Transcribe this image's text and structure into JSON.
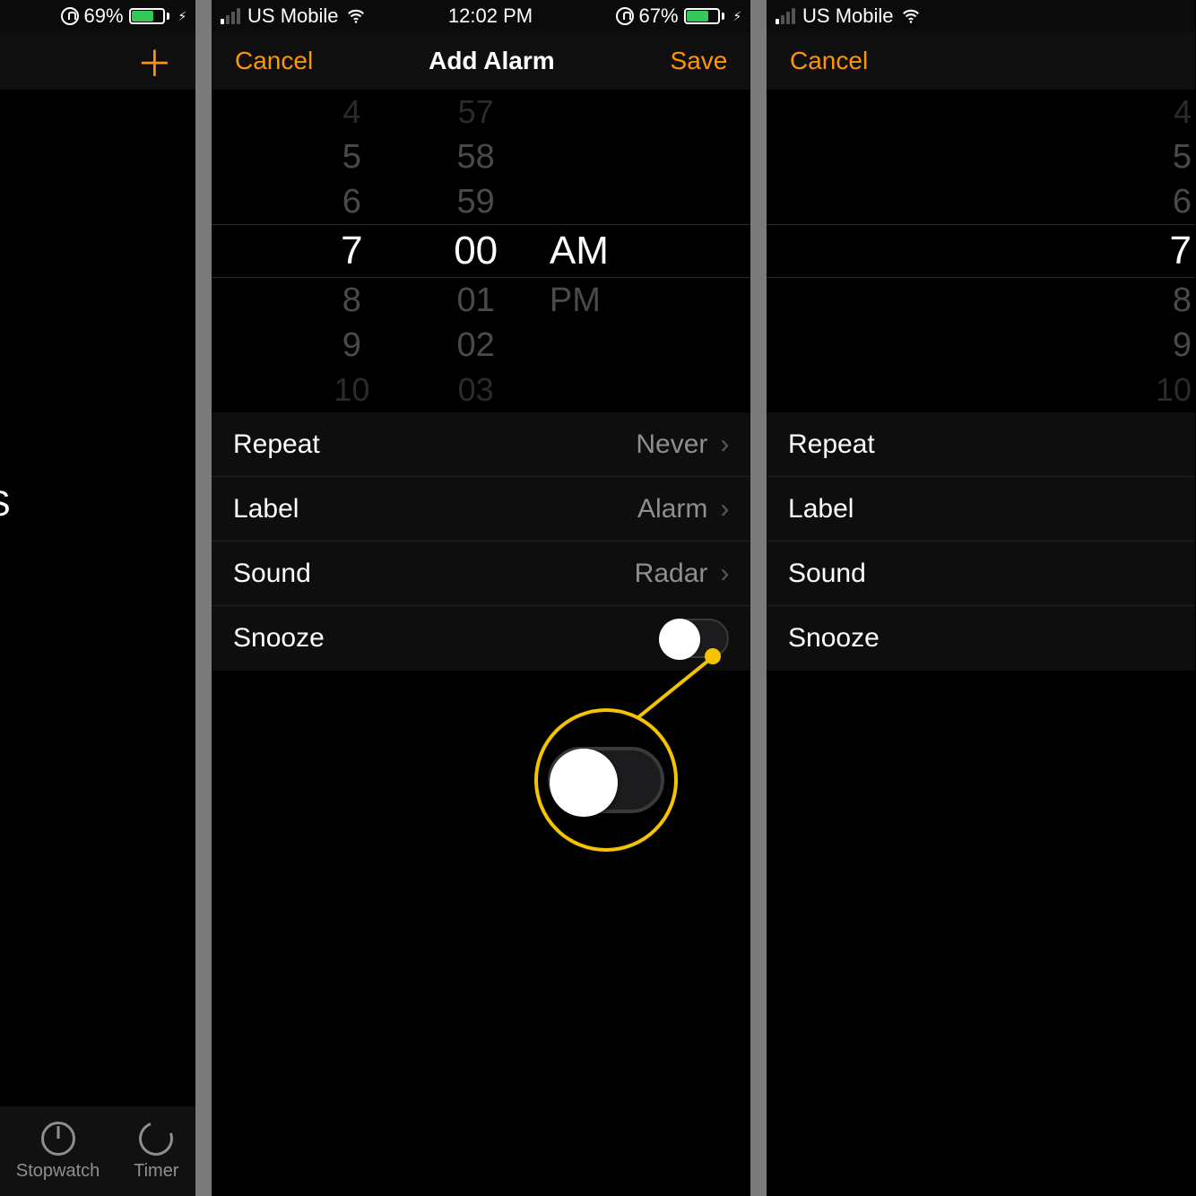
{
  "accent": "#ff9500",
  "status_left": {
    "battery_pct": "69%",
    "battery_fill_pct": 69
  },
  "status_mid": {
    "carrier": "US Mobile",
    "time": "12:02 PM",
    "battery_pct": "67%",
    "battery_fill_pct": 67
  },
  "status_right": {
    "carrier": "US Mobile"
  },
  "nav_mid": {
    "cancel": "Cancel",
    "title": "Add Alarm",
    "save": "Save"
  },
  "nav_right": {
    "cancel": "Cancel"
  },
  "picker": {
    "hours": [
      "4",
      "5",
      "6",
      "7",
      "8",
      "9",
      "10"
    ],
    "minutes": [
      "57",
      "58",
      "59",
      "00",
      "01",
      "02",
      "03"
    ],
    "period": [
      "",
      "",
      "",
      "AM",
      "PM",
      "",
      ""
    ]
  },
  "rows": {
    "repeat": {
      "label": "Repeat",
      "value": "Never"
    },
    "label": {
      "label": "Label",
      "value": "Alarm"
    },
    "sound": {
      "label": "Sound",
      "value": "Radar"
    },
    "snooze": {
      "label": "Snooze"
    }
  },
  "left_tabs": {
    "stopwatch": "Stopwatch",
    "timer": "Timer"
  },
  "left_letter": "S"
}
